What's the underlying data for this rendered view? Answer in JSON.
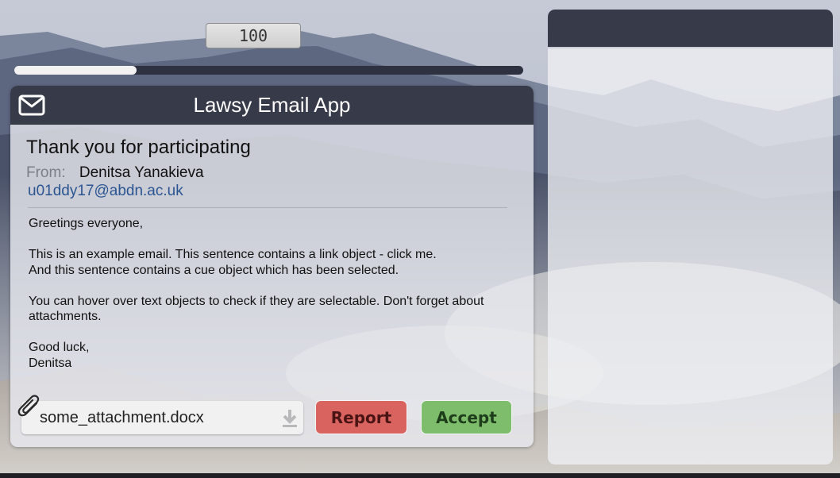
{
  "score": {
    "value": "100"
  },
  "progress": {
    "fraction": 0.24
  },
  "email_app": {
    "title": "Lawsy Email App",
    "icon": "mail-icon",
    "subject": "Thank you for participating",
    "from_label": "From:",
    "sender_name": "Denitsa Yanakieva",
    "sender_email": "u01ddy17@abdn.ac.uk",
    "body": [
      "Greetings everyone,",
      "This is an example email. This sentence contains a link object - click me.\nAnd this sentence contains a cue object which has been selected.",
      "You can hover over text objects to check if they are selectable. Don't forget about attachments.",
      "Good luck,\nDenitsa"
    ],
    "attachment": {
      "icon": "paperclip-icon",
      "name": "some_attachment.docx",
      "download_icon": "download-icon"
    },
    "report_label": "Report",
    "accept_label": "Accept"
  },
  "colors": {
    "header": "#373a49",
    "report": "#d9635f",
    "accept": "#7dbd6b",
    "link": "#2b5591"
  }
}
